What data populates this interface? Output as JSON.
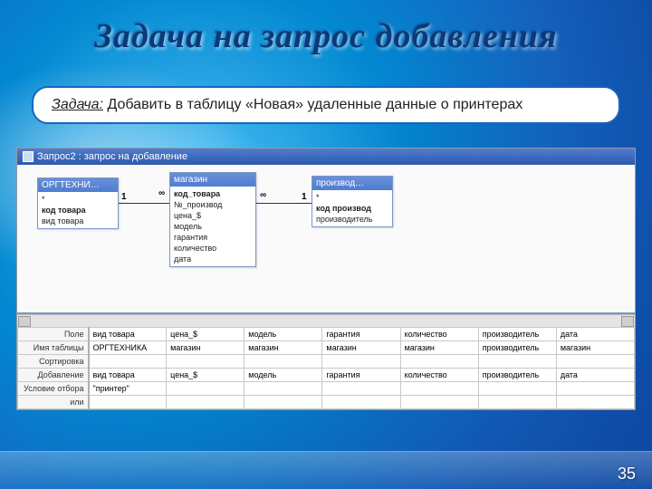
{
  "slide": {
    "title": "Задача на запрос добавления",
    "task_label": "Задача:",
    "task_text": " Добавить в таблицу «Новая» удаленные данные о принтерах",
    "page_number": "35"
  },
  "window": {
    "title": "Запрос2 : запрос на добавление"
  },
  "tables": {
    "t1": {
      "caption": "ОРГТЕХНИ…",
      "fields": [
        "*",
        "код товара",
        "вид товара"
      ]
    },
    "t2": {
      "caption": "магазин",
      "fields": [
        "код_товара",
        "№_производ",
        "цена_$",
        "модель",
        "гарантия",
        "количество",
        "дата"
      ]
    },
    "t3": {
      "caption": "производ…",
      "fields": [
        "*",
        "код производ",
        "производитель"
      ]
    }
  },
  "rel": {
    "one_a": "1",
    "many_a": "∞",
    "one_b": "1",
    "many_b": "∞"
  },
  "grid": {
    "row_labels": [
      "Поле",
      "Имя таблицы",
      "Сортировка",
      "Добавление",
      "Условие отбора",
      "или"
    ],
    "cols": [
      {
        "field": "вид товара",
        "table": "ОРГТЕХНИКА",
        "append": "вид товара",
        "criteria": "\"принтер\""
      },
      {
        "field": "цена_$",
        "table": "магазин",
        "append": "цена_$",
        "criteria": ""
      },
      {
        "field": "модель",
        "table": "магазин",
        "append": "модель",
        "criteria": ""
      },
      {
        "field": "гарантия",
        "table": "магазин",
        "append": "гарантия",
        "criteria": ""
      },
      {
        "field": "количество",
        "table": "магазин",
        "append": "количество",
        "criteria": ""
      },
      {
        "field": "производитель",
        "table": "производитель",
        "append": "производитель",
        "criteria": ""
      },
      {
        "field": "дата",
        "table": "магазин",
        "append": "дата",
        "criteria": ""
      }
    ]
  }
}
